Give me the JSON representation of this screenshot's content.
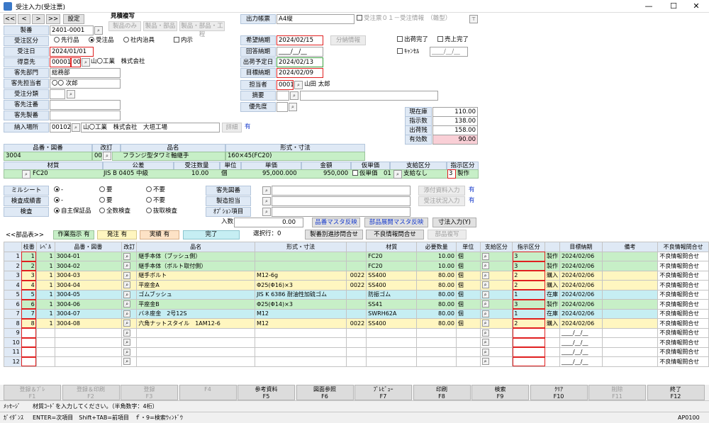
{
  "window": {
    "title": "受注入力(受注票)",
    "min": "—",
    "max": "☐",
    "close": "✕"
  },
  "nav": {
    "first": "<<",
    "prev": "<",
    "next": ">",
    "last": ">>",
    "settings": "設定"
  },
  "mitsumori": {
    "label": "見積複写",
    "b1": "製品のみ",
    "b2": "製品・部品",
    "b3": "製品・部品・工程"
  },
  "form": {
    "seiban_label": "製番",
    "seiban": "2401-0001",
    "kubun_label": "受注区分",
    "kubun_opts": [
      "先行品",
      "受注品",
      "社内治具"
    ],
    "uchiji": "内示",
    "jutyubi_label": "受注日",
    "jutyubi": "2024/01/01",
    "tokuisaki_label": "得意先",
    "tokuisaki_code": "00001",
    "tokuisaki_sub": "00",
    "tokuisaki_name": "山〇工業　株式会社",
    "bumon_label": "客先部門",
    "bumon": "総務部",
    "tanto_label": "客先担当者",
    "tanto": "〇〇 次郎",
    "bunrui_label": "受注分類",
    "chumon_label": "客先注番",
    "seiban2_label": "客先製番",
    "nonyu_label": "納入場所",
    "nonyu_code": "00102",
    "nonyu_name": "山〇工業　株式会社　大垣工場",
    "nonyu_btn": "詳細",
    "nonyu_flag": "有",
    "shutsuryoku_label": "出力帳票",
    "shutsuryoku": "A4縦",
    "shutsuryoku_opt": "受注票０１－受注情報　（雛型）",
    "kibo_label": "希望納期",
    "kibo": "2024/02/15",
    "bunkatsu": "分納情報",
    "kaito_label": "回答納期",
    "kaito": "____/__/__",
    "shukka_label": "出荷予定日",
    "shukka": "2024/02/13",
    "mokuhyo_label": "目標納期",
    "mokuhyo": "2024/02/09",
    "tantosha_label": "担当者",
    "tantosha_code": "0001",
    "tantosha_name": "山田 太郎",
    "tekiyo_label": "摘要",
    "yusen_label": "優先度",
    "shukka_kanryo": "出荷完了",
    "uriage_kanryo": "売上完了",
    "cancel": "ｷｬﾝｾﾙ",
    "cancel_date": "____/__/__"
  },
  "stock": [
    {
      "label": "現在庫",
      "value": "110.00"
    },
    {
      "label": "指示数",
      "value": "138.00"
    },
    {
      "label": "出荷残",
      "value": "158.00"
    },
    {
      "label": "有効数",
      "value": "90.00"
    }
  ],
  "product": {
    "h_hinban": "品番・図番",
    "h_kaitei": "改訂",
    "h_hinmei": "品名",
    "h_keishiki": "形式・寸法",
    "hinban": "3004",
    "kaitei": "00",
    "hinmei": "フランジ型タワミ軸継手",
    "keishiki": "160×45(FC20)",
    "h_zairyo": "材質",
    "h_kokaku": "公差",
    "h_suryo": "受注数量",
    "h_tani": "単位",
    "h_tanka": "単価",
    "h_kingaku": "金額",
    "h_karitanka": "仮単価",
    "h_shikyu": "支給区分",
    "h_shiji": "指示区分",
    "zairyo": "FC20",
    "kokaku": "JIS B 0405 中級",
    "suryo": "10.00",
    "tani": "個",
    "tanka": "95,000.000",
    "kingaku": "950,000",
    "karitanka": "仮単価",
    "karitanka_code": "01",
    "shikyu": "支給なし",
    "shiji_code": "3",
    "shiji": "製作"
  },
  "options": {
    "millsheet_label": "ミルシート",
    "millsheet": [
      "-",
      "要",
      "不要"
    ],
    "kensa_sho_label": "検査成績書",
    "kensa_sho": [
      "-",
      "要",
      "不要"
    ],
    "kensa_label": "検査",
    "kensa": [
      "自主保証品",
      "全数検査",
      "抜取検査"
    ],
    "zuban_label": "客先図番",
    "seizo_label": "製造担当",
    "option_label": "ｵﾌﾟｼｮﾝ項目",
    "nyuryoku_label": "入数",
    "nyuryoku": "0.00",
    "tenpu_btn": "添付資料入力",
    "tenpu_flag": "有",
    "jutyu_btn": "受注状況入力",
    "jutyu_flag": "有",
    "hinmoku_btn": "品番マスタ反映",
    "buhin_btn": "部品展開マスタ反映",
    "sunpo_btn": "寸法入力(Y)",
    "sentaku": "選択行：0",
    "seiban_btn": "製番別進捗問合せ",
    "furyo_btn": "不良情報問合せ",
    "buhin_copy": "部品複写"
  },
  "legend": {
    "buhin": "<<部品表>>",
    "sagyo": "作業指示 有",
    "hatchu": "発注 有",
    "jisseki": "実績 有",
    "kanryo": "完了"
  },
  "grid": {
    "headers": [
      "",
      "枝番",
      "ﾚﾍﾞﾙ",
      "品番・図番",
      "改訂",
      "品名",
      "形式・寸法",
      "",
      "材質",
      "必要数量",
      "単位",
      "支給区分",
      "指示区分",
      "",
      "目標納期",
      "備考",
      "不良情報問合せ"
    ],
    "rows": [
      {
        "n": "1",
        "eda": "1",
        "lv": "1",
        "hin": "3004-01",
        "name": "継手本体（ブッシュ側）",
        "kei": "",
        "code": "",
        "zai": "FC20",
        "qty": "10.00",
        "unit": "個",
        "sk": "3",
        "sj": "製作",
        "date": "2024/02/06",
        "q": "不良情報問合せ",
        "c": "grn"
      },
      {
        "n": "2",
        "eda": "2",
        "lv": "1",
        "hin": "3004-02",
        "name": "継手本体（ボルト取付側）",
        "kei": "",
        "code": "",
        "zai": "FC20",
        "qty": "10.00",
        "unit": "個",
        "sk": "3",
        "sj": "製作",
        "date": "2024/02/06",
        "q": "不良情報問合せ",
        "c": "grn"
      },
      {
        "n": "3",
        "eda": "3",
        "lv": "1",
        "hin": "3004-03",
        "name": "継手ボルト",
        "kei": "M12-6g",
        "code": "0022",
        "zai": "SS400",
        "qty": "80.00",
        "unit": "個",
        "sk": "2",
        "sj": "購入",
        "date": "2024/02/06",
        "q": "不良情報問合せ",
        "c": "yel"
      },
      {
        "n": "4",
        "eda": "4",
        "lv": "1",
        "hin": "3004-04",
        "name": "平座金A",
        "kei": "Φ25(Φ16)×3",
        "code": "0022",
        "zai": "SS400",
        "qty": "80.00",
        "unit": "個",
        "sk": "2",
        "sj": "購入",
        "date": "2024/02/06",
        "q": "不良情報問合せ",
        "c": "yel"
      },
      {
        "n": "5",
        "eda": "5",
        "lv": "1",
        "hin": "3004-05",
        "name": "ゴムブッシュ",
        "kei": "JIS K 6386 耐油性加硫ゴム",
        "code": "",
        "zai": "防振ゴム",
        "qty": "80.00",
        "unit": "個",
        "sk": "1",
        "sj": "在庫",
        "date": "2024/02/06",
        "q": "不良情報問合せ",
        "c": "cyn"
      },
      {
        "n": "6",
        "eda": "6",
        "lv": "1",
        "hin": "3004-06",
        "name": "平座金B",
        "kei": "Φ25(Φ14)×3",
        "code": "",
        "zai": "SS41",
        "qty": "80.00",
        "unit": "個",
        "sk": "3",
        "sj": "製作",
        "date": "2024/02/06",
        "q": "不良情報問合せ",
        "c": "grn"
      },
      {
        "n": "7",
        "eda": "7",
        "lv": "1",
        "hin": "3004-07",
        "name": "バネ座金　2号12S",
        "kei": "M12",
        "code": "",
        "zai": "SWRH62A",
        "qty": "80.00",
        "unit": "個",
        "sk": "1",
        "sj": "在庫",
        "date": "2024/02/06",
        "q": "不良情報問合せ",
        "c": "cyn"
      },
      {
        "n": "8",
        "eda": "8",
        "lv": "1",
        "hin": "3004-08",
        "name": "六角ナットスタイル　1AM12-6",
        "kei": "M12",
        "code": "0022",
        "zai": "SS400",
        "qty": "80.00",
        "unit": "個",
        "sk": "2",
        "sj": "購入",
        "date": "2024/02/06",
        "q": "不良情報問合せ",
        "c": "yel"
      },
      {
        "n": "9",
        "eda": "",
        "lv": "",
        "hin": "",
        "name": "",
        "kei": "",
        "code": "",
        "zai": "",
        "qty": "",
        "unit": "",
        "sk": "",
        "sj": "",
        "date": "____/__/__",
        "q": "不良情報問合せ",
        "c": ""
      },
      {
        "n": "10",
        "eda": "",
        "lv": "",
        "hin": "",
        "name": "",
        "kei": "",
        "code": "",
        "zai": "",
        "qty": "",
        "unit": "",
        "sk": "",
        "sj": "",
        "date": "____/__/__",
        "q": "不良情報問合せ",
        "c": ""
      },
      {
        "n": "11",
        "eda": "",
        "lv": "",
        "hin": "",
        "name": "",
        "kei": "",
        "code": "",
        "zai": "",
        "qty": "",
        "unit": "",
        "sk": "",
        "sj": "",
        "date": "____/__/__",
        "q": "不良情報問合せ",
        "c": ""
      },
      {
        "n": "12",
        "eda": "",
        "lv": "",
        "hin": "",
        "name": "",
        "kei": "",
        "code": "",
        "zai": "",
        "qty": "",
        "unit": "",
        "sk": "",
        "sj": "",
        "date": "____/__/__",
        "q": "不良情報問合せ",
        "c": ""
      }
    ]
  },
  "fkeys": [
    {
      "l1": "登録＆ﾌﾟﾚ",
      "l2": "F1",
      "dis": true
    },
    {
      "l1": "登録＆印刷",
      "l2": "F2",
      "dis": true
    },
    {
      "l1": "登録",
      "l2": "F3",
      "dis": true
    },
    {
      "l1": "",
      "l2": "F4",
      "dis": true
    },
    {
      "l1": "参考資料",
      "l2": "F5",
      "dis": false
    },
    {
      "l1": "図面参照",
      "l2": "F6",
      "dis": false
    },
    {
      "l1": "ﾌﾟﾚﾋﾞｭｰ",
      "l2": "F7",
      "dis": false
    },
    {
      "l1": "印刷",
      "l2": "F8",
      "dis": false
    },
    {
      "l1": "検索",
      "l2": "F9",
      "dis": false
    },
    {
      "l1": "ｸﾘｱ",
      "l2": "F10",
      "dis": false
    },
    {
      "l1": "削除",
      "l2": "F11",
      "dis": true
    },
    {
      "l1": "終了",
      "l2": "F12",
      "dis": false
    }
  ],
  "status": {
    "msg_label": "ﾒｯｾｰｼﾞ",
    "msg": "材質ｺｰﾄﾞを入力してください。（半角数字：4桁）",
    "guide_label": "ｶﾞｲﾀﾞﾝｽ",
    "guide": "ENTER=次項目　Shift+TAB=前項目　ｆ・9=検索ｳｨﾝﾄﾞｳ",
    "code": "AP0100"
  },
  "colors": {
    "green": "#c7efc7",
    "yellow": "#fff6c0",
    "cyan": "#c6eef3",
    "label": "#dfe9f5",
    "red": "#e02020",
    "link": "#1a3dcc"
  }
}
